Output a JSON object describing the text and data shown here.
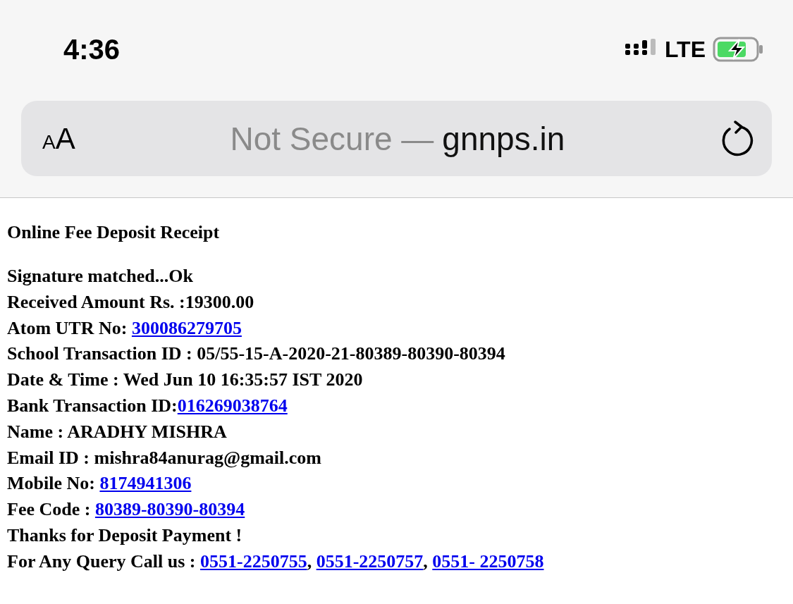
{
  "status_bar": {
    "time": "4:36",
    "network": "LTE"
  },
  "address_bar": {
    "text_size_button": {
      "small": "A",
      "large": "A"
    },
    "security": "Not Secure —",
    "domain": "gnnps.in"
  },
  "receipt": {
    "title": "Online Fee Deposit Receipt",
    "lines": [
      [
        {
          "kind": "text",
          "text": "Signature matched...Ok"
        }
      ],
      [
        {
          "kind": "text",
          "text": "Received Amount Rs. :19300.00"
        }
      ],
      [
        {
          "kind": "text",
          "text": "Atom UTR No: "
        },
        {
          "kind": "link",
          "text": "300086279705"
        }
      ],
      [
        {
          "kind": "text",
          "text": "School Transaction ID : 05/55-15-A-2020-21-80389-80390-80394"
        }
      ],
      [
        {
          "kind": "text",
          "text": "Date & Time : Wed Jun 10 16:35:57 IST 2020"
        }
      ],
      [
        {
          "kind": "text",
          "text": "Bank Transaction ID:"
        },
        {
          "kind": "link",
          "text": "016269038764"
        }
      ],
      [
        {
          "kind": "text",
          "text": "Name : ARADHY MISHRA"
        }
      ],
      [
        {
          "kind": "text",
          "text": "Email ID : mishra84anurag@gmail.com"
        }
      ],
      [
        {
          "kind": "text",
          "text": "Mobile No: "
        },
        {
          "kind": "link",
          "text": "8174941306"
        }
      ],
      [
        {
          "kind": "text",
          "text": "Fee Code : "
        },
        {
          "kind": "link",
          "text": "80389-80390-80394"
        }
      ],
      [
        {
          "kind": "text",
          "text": "Thanks for Deposit Payment !"
        }
      ],
      [
        {
          "kind": "text",
          "text": "For Any Query Call us : "
        },
        {
          "kind": "link",
          "text": "0551-2250755"
        },
        {
          "kind": "text",
          "text": ", "
        },
        {
          "kind": "link",
          "text": "0551-2250757"
        },
        {
          "kind": "text",
          "text": ", "
        },
        {
          "kind": "link",
          "text": "0551- 2250758"
        }
      ]
    ]
  }
}
